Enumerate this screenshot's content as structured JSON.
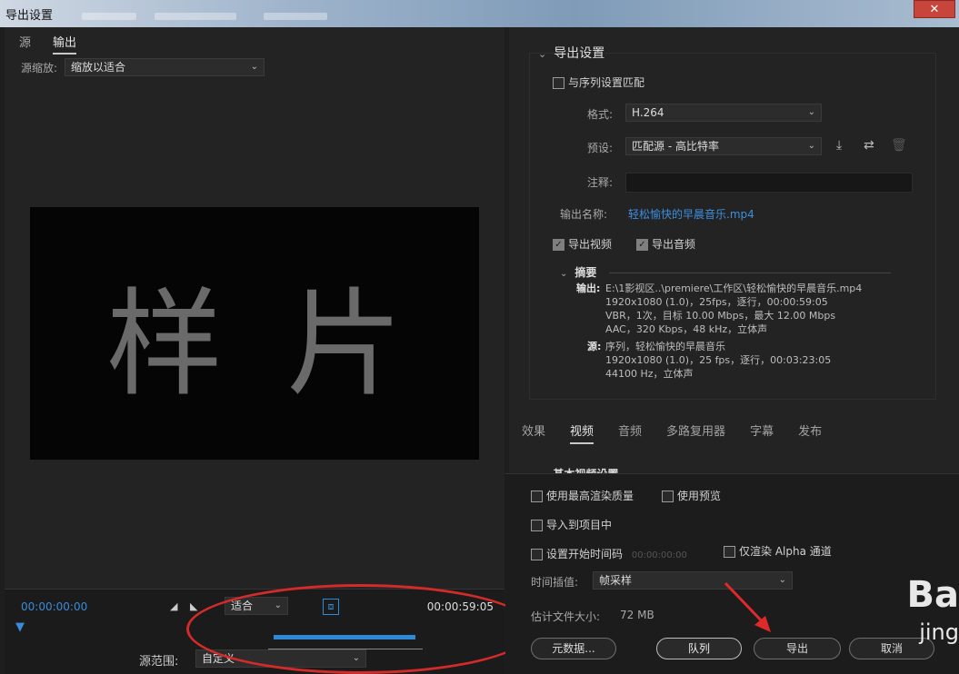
{
  "window": {
    "title": "导出设置",
    "close_label": "✕"
  },
  "left": {
    "tabs": [
      {
        "label": "源"
      },
      {
        "label": "输出"
      }
    ],
    "source_scaling": {
      "label": "源缩放:",
      "value": "缩放以适合"
    },
    "preview_text": "样片",
    "timeline": {
      "current_time": "00:00:00:00",
      "end_time": "00:00:59:05",
      "zoom_value": "适合",
      "range_label": "源范围:",
      "range_value": "自定义"
    }
  },
  "export_settings": {
    "header": "导出设置",
    "match_sequence": {
      "label": "与序列设置匹配",
      "checked": false
    },
    "format": {
      "label": "格式:",
      "value": "H.264"
    },
    "preset": {
      "label": "预设:",
      "value": "匹配源 - 高比特率"
    },
    "comments": {
      "label": "注释:",
      "value": ""
    },
    "output_name": {
      "label": "输出名称:",
      "value": "轻松愉快的早晨音乐.mp4"
    },
    "export_video": {
      "label": "导出视频",
      "checked": true
    },
    "export_audio": {
      "label": "导出音频",
      "checked": true
    },
    "summary": {
      "header": "摘要",
      "output_label": "输出:",
      "output_lines": [
        "E:\\1影视区..\\premiere\\工作区\\轻松愉快的早晨音乐.mp4",
        "1920x1080 (1.0)，25fps，逐行，00:00:59:05",
        "VBR，1次，目标 10.00 Mbps，最大 12.00 Mbps",
        "AAC，320 Kbps，48 kHz，立体声"
      ],
      "source_label": "源:",
      "source_lines": [
        "序列，轻松愉快的早晨音乐",
        "1920x1080 (1.0)，25 fps，逐行，00:03:23:05",
        "44100 Hz，立体声"
      ]
    }
  },
  "tabs2": [
    {
      "label": "效果"
    },
    {
      "label": "视频"
    },
    {
      "label": "音频"
    },
    {
      "label": "多路复用器"
    },
    {
      "label": "字幕"
    },
    {
      "label": "发布"
    }
  ],
  "basic_video": {
    "header": "基本视频设置"
  },
  "options": {
    "max_render_quality": "使用最高渲染质量",
    "use_previews": "使用预览",
    "import_into_project": "导入到项目中",
    "set_start_timecode": "设置开始时间码",
    "start_timecode_value": "00:00:00:00",
    "render_alpha_only": "仅渲染 Alpha 通道",
    "interpolation_label": "时间插值:",
    "interpolation_value": "帧采样",
    "file_size_label": "估计文件大小:",
    "file_size_value": "72 MB"
  },
  "buttons": {
    "metadata": "元数据...",
    "queue": "队列",
    "export": "导出",
    "cancel": "取消"
  },
  "watermark": {
    "big": "Ba",
    "small": "jing"
  }
}
